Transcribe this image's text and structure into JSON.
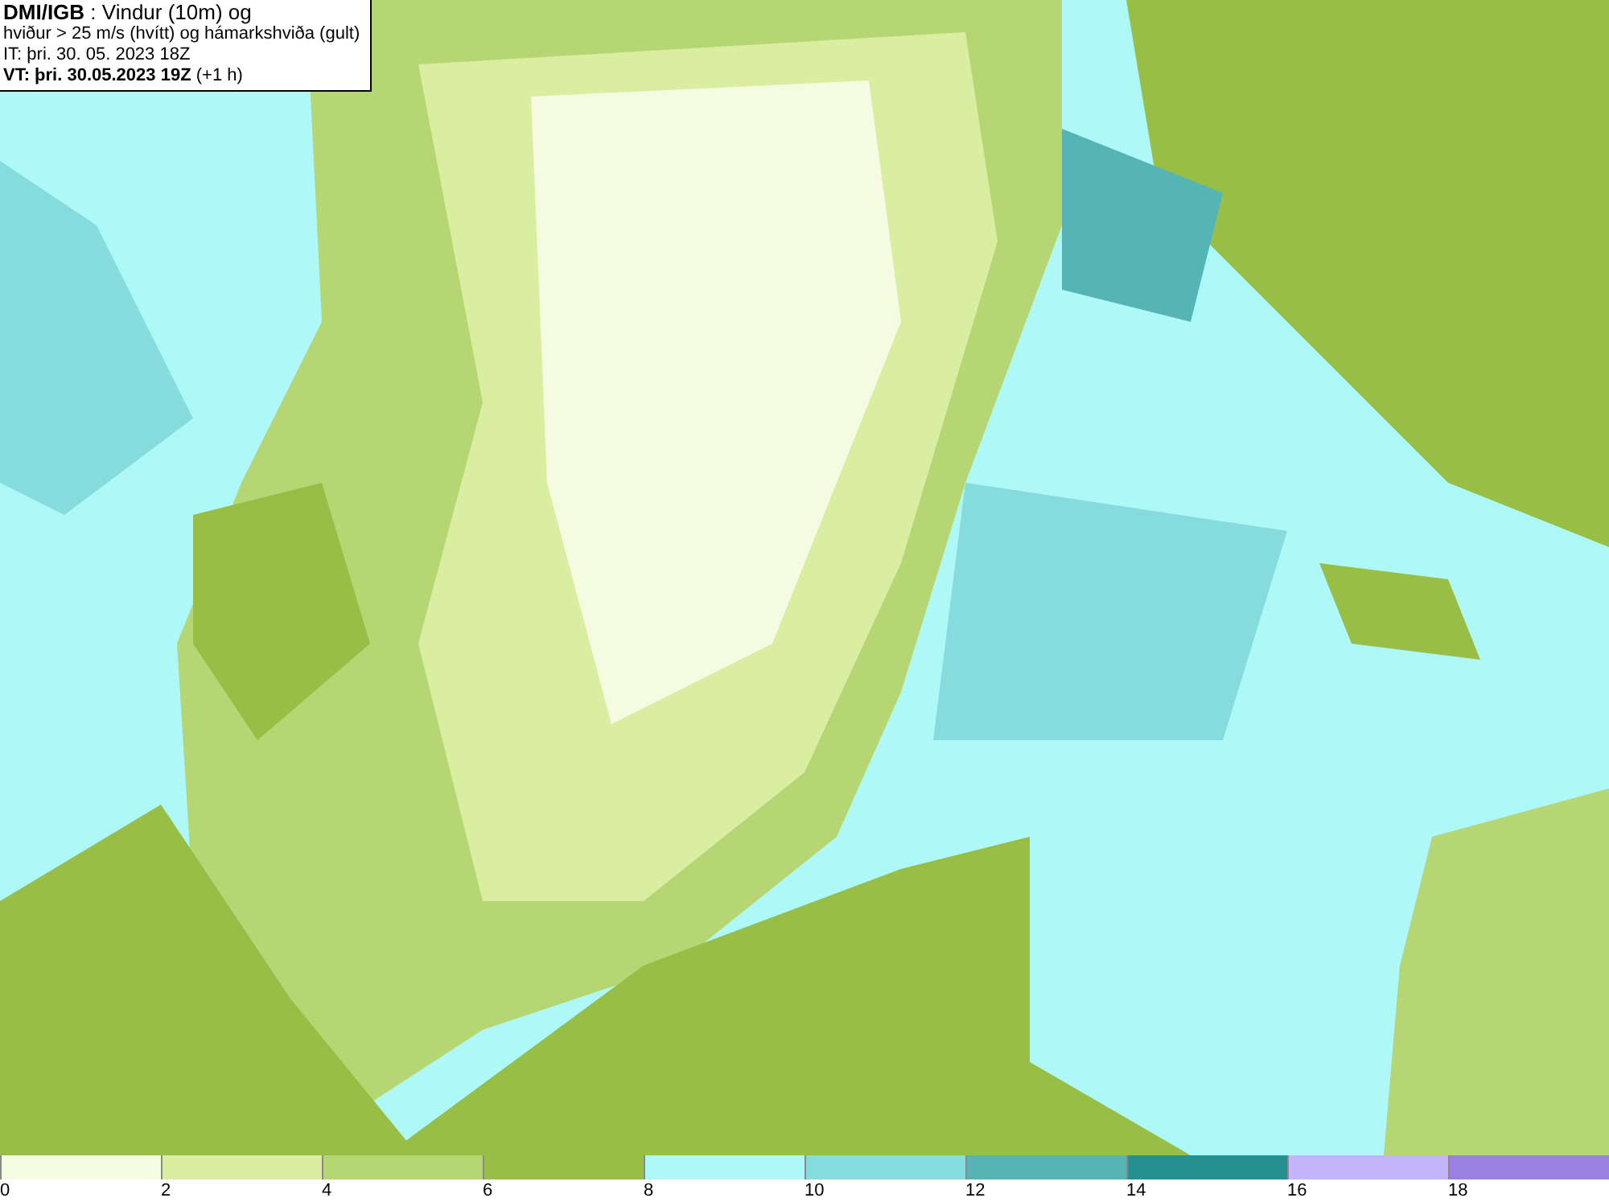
{
  "header": {
    "lines": [
      "**DMI/IGB** : Vindur (10m) og",
      "hviður > 25 m/s (hvítt) og hámarkshviða (gult)",
      "IT: þri. 30. 05. 2023 18Z",
      "**VT: þri. 30.05.2023 19Z** (+1 h)"
    ]
  },
  "legend": [
    {
      "label": "0",
      "color": "#f4fbe0"
    },
    {
      "label": "2",
      "color": "#d9eea0"
    },
    {
      "label": "4",
      "color": "#b6d673"
    },
    {
      "label": "6",
      "color": "#98be45"
    },
    {
      "label": "8",
      "color": "#aef8f8"
    },
    {
      "label": "10",
      "color": "#86dcdc"
    },
    {
      "label": "12",
      "color": "#55b4b4"
    },
    {
      "label": "14",
      "color": "#259090"
    },
    {
      "label": "16",
      "color": "#c4b4fc"
    },
    {
      "label": "18",
      "color": "#9a80e0"
    }
  ]
}
